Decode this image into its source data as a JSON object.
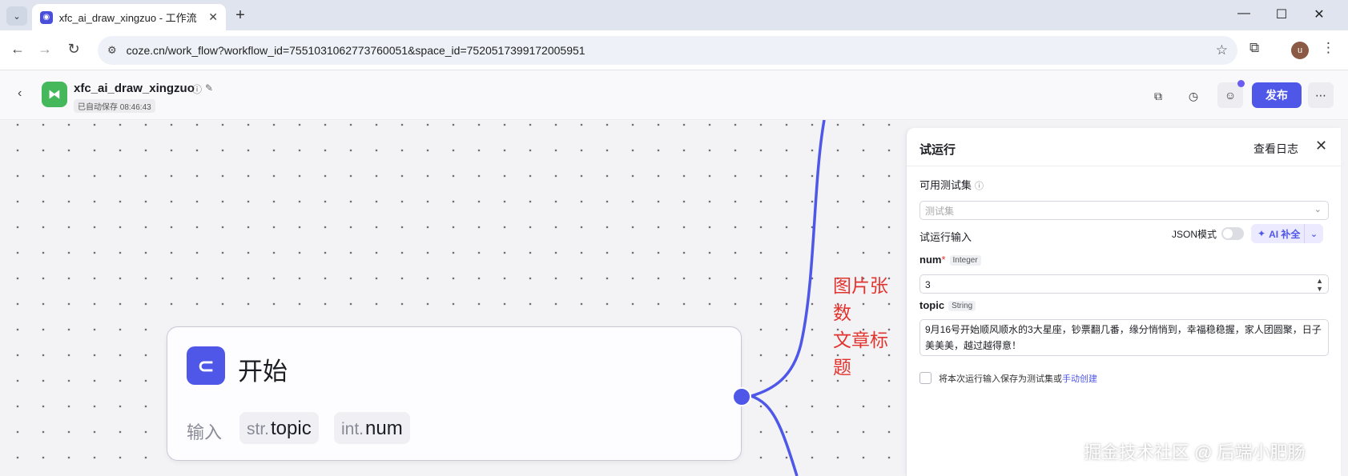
{
  "browser": {
    "tab_title": "xfc_ai_draw_xingzuo - 工作流",
    "url": "coze.cn/work_flow?workflow_id=7551031062773760051&space_id=7520517399172005951",
    "profile_initial": "u"
  },
  "header": {
    "app_name": "xfc_ai_draw_xingzuo",
    "autosave": "已自动保存 08:46:43",
    "publish_label": "发布"
  },
  "canvas": {
    "node": {
      "title": "开始",
      "inputs_label": "输入",
      "inputs": [
        {
          "type": "str.",
          "name": "topic"
        },
        {
          "type": "int.",
          "name": "num"
        }
      ]
    },
    "annotations": [
      "图片张数",
      "文章标题"
    ]
  },
  "panel": {
    "title": "试运行",
    "view_log": "查看日志",
    "testset_label": "可用测试集",
    "testset_placeholder": "测试集",
    "input_label": "试运行输入",
    "json_mode_label": "JSON模式",
    "ai_fill_label": "AI 补全",
    "fields": [
      {
        "name": "num",
        "required": "*",
        "type": "Integer",
        "value": "3"
      },
      {
        "name": "topic",
        "required": "",
        "type": "String",
        "value": "9月16号开始顺风顺水的3大星座，钞票翻几番，缘分悄悄到，幸福稳稳握，家人团圆聚，日子美美美，越过越得意！"
      }
    ],
    "save_label": "将本次运行输入保存为测试集或",
    "save_link": "手动创建"
  },
  "watermark": "掘金技术社区 @ 后端小肥肠",
  "colors": {
    "accent": "#4f57e8",
    "annotation": "#e2342e",
    "logo_green": "#46b85c"
  }
}
